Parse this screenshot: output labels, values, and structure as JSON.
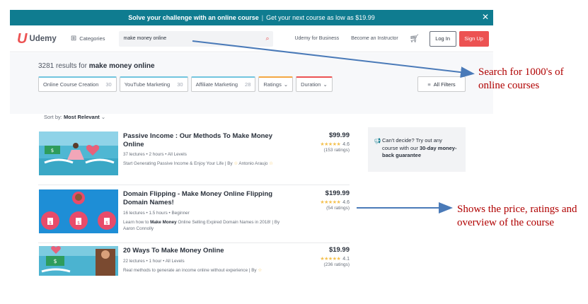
{
  "banner": {
    "bold_text": "Solve your challenge with an online course",
    "separator": "|",
    "rest_text": "Get your next course as low as $19.99",
    "close_glyph": "✕"
  },
  "nav": {
    "logo_mark": "U",
    "logo_word": "Udemy",
    "categories_label": "Categories",
    "search_value": "make money online",
    "business_label": "Udemy for Business",
    "instructor_label": "Become an Instructor",
    "login_label": "Log In",
    "signup_label": "Sign Up"
  },
  "filters": {
    "results_prefix": "3281 results for ",
    "results_query": "make money online",
    "chips": [
      {
        "label": "Online Course Creation",
        "count": "30"
      },
      {
        "label": "YouTube Marketing",
        "count": "30"
      },
      {
        "label": "Affiliate Marketing",
        "count": "28"
      },
      {
        "label": "Ratings",
        "caret": "⌄"
      },
      {
        "label": "Duration",
        "caret": "⌄"
      }
    ],
    "all_filters_label": "All Filters"
  },
  "sort": {
    "prefix": "Sort by: ",
    "value": "Most Relevant",
    "caret": "⌄"
  },
  "courses": [
    {
      "title": "Passive Income : Our Methods To Make Money Online",
      "lectures": "37 lectures",
      "hours": "2 hours",
      "level": "All Levels",
      "desc_pre": "Start Generating Passive Income & Enjoy Your Life | By ",
      "desc_bold": "",
      "desc_post": "Antonio Araujo",
      "price": "$99.99",
      "stars": "★★★★★",
      "rating": "4.6",
      "ratings_count": "(153 ratings)",
      "rating_value": 4.6
    },
    {
      "title": "Domain Flipping - Make Money Online Flipping Domain Names!",
      "lectures": "16 lectures",
      "hours": "1.5 hours",
      "level": "Beginner",
      "desc_pre": "Learn how to ",
      "desc_bold": "Make Money",
      "desc_post": " Online Selling Expired Domain Names in 2018! | By Aaron Connolly",
      "price": "$199.99",
      "stars": "★★★★★",
      "rating": "4.6",
      "ratings_count": "(54 ratings)",
      "rating_value": 4.6
    },
    {
      "title": "20 Ways To Make Money Online",
      "lectures": "22 lectures",
      "hours": "1 hour",
      "level": "All Levels",
      "desc_pre": "Real methods to generate an income online without experience | By ",
      "desc_bold": "",
      "desc_post": "",
      "price": "$19.99",
      "stars": "★★★★★",
      "rating": "4.1",
      "ratings_count": "(236 ratings)",
      "rating_value": 4.1
    }
  ],
  "guarantee": {
    "line1": "Can't decide? Try out any course with our ",
    "bold": "30-day money-back guarantee"
  },
  "annotations": {
    "search": "Search for 1000's of online courses",
    "price": "Shows the price, ratings and overview of the course"
  },
  "colors": {
    "banner": "#0f7c90",
    "brand": "#ec5252",
    "annotation": "#b00000",
    "arrow": "#4a7ab8"
  }
}
